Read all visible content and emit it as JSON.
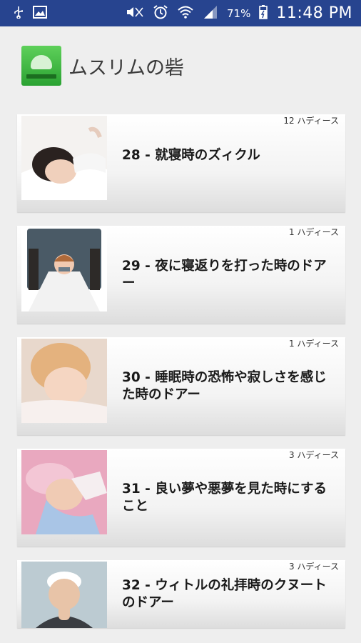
{
  "status_bar": {
    "left_icons": [
      "usb-icon",
      "image-icon"
    ],
    "right_icons": [
      "mute-icon",
      "alarm-icon",
      "wifi-icon",
      "signal-icon",
      "battery-icon"
    ],
    "battery_percent": "71%",
    "time": "11:48 PM",
    "color": "#27448f"
  },
  "app_bar": {
    "title": "ムスリムの砦",
    "logo_icon": "fortress-logo-icon"
  },
  "items": [
    {
      "count": "12 ハディース",
      "title": "28 - 就寝時のズィクル",
      "thumb": "sleeping-child-image"
    },
    {
      "count": "1 ハディース",
      "title": "29 - 夜に寝返りを打った時のドアー",
      "thumb": "child-in-bed-illustration"
    },
    {
      "count": "1 ハディース",
      "title": "30 - 睡眠時の恐怖や寂しさを感じた時のドアー",
      "thumb": "sleeping-toddler-image"
    },
    {
      "count": "3 ハディース",
      "title": "31 - 良い夢や悪夢を見た時にすること",
      "thumb": "sleeping-baby-image"
    },
    {
      "count": "3 ハディース",
      "title": "32 - ウィトルの礼拝時のクヌートのドアー",
      "thumb": "praying-child-image"
    }
  ]
}
